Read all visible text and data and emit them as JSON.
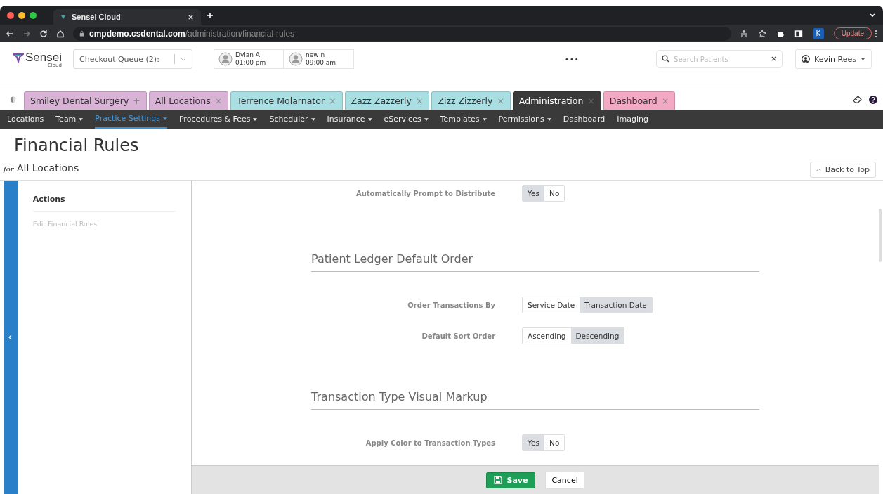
{
  "browser": {
    "tab_title": "Sensei Cloud",
    "url_host": "cmpdemo.csdental.com",
    "url_path": "/administration/financial-rules",
    "avatar_letter": "K",
    "update_label": "Update"
  },
  "header": {
    "logo": "Sensei",
    "logo_sub": "Cloud",
    "checkout_queue": "Checkout Queue (2):",
    "appointments": [
      {
        "name": "Dylan A",
        "time": "01:00 pm"
      },
      {
        "name": "new n",
        "time": "09:00 am"
      }
    ],
    "more": "•••",
    "search_placeholder": "Search Patients",
    "user": "Kevin Rees"
  },
  "tabs": [
    {
      "label": "Smiley Dental Surgery",
      "mark": "+",
      "color": "#d9b3d6",
      "selected": false
    },
    {
      "label": "All Locations",
      "mark": "×",
      "color": "#d9b3d6",
      "selected": false
    },
    {
      "label": "Terrence Molarnator",
      "mark": "×",
      "color": "#a9dfe3",
      "selected": false
    },
    {
      "label": "Zazz Zazzerly",
      "mark": "×",
      "color": "#a9dfe3",
      "selected": false
    },
    {
      "label": "Zizz Zizzerly",
      "mark": "×",
      "color": "#a9dfe3",
      "selected": false
    },
    {
      "label": "Administration",
      "mark": "×",
      "color": "#3a3a3a",
      "selected": true
    },
    {
      "label": "Dashboard",
      "mark": "×",
      "color": "#f3a9c4",
      "selected": false
    }
  ],
  "nav": [
    {
      "label": "Locations",
      "dropdown": false,
      "selected": false
    },
    {
      "label": "Team",
      "dropdown": true,
      "selected": false
    },
    {
      "label": "Practice Settings",
      "dropdown": true,
      "selected": true
    },
    {
      "label": "Procedures & Fees",
      "dropdown": true,
      "selected": false
    },
    {
      "label": "Scheduler",
      "dropdown": true,
      "selected": false
    },
    {
      "label": "Insurance",
      "dropdown": true,
      "selected": false
    },
    {
      "label": "eServices",
      "dropdown": true,
      "selected": false
    },
    {
      "label": "Templates",
      "dropdown": true,
      "selected": false
    },
    {
      "label": "Permissions",
      "dropdown": true,
      "selected": false
    },
    {
      "label": "Dashboard",
      "dropdown": false,
      "selected": false
    },
    {
      "label": "Imaging",
      "dropdown": false,
      "selected": false
    }
  ],
  "page": {
    "title": "Financial Rules",
    "subtitle_prefix": "for",
    "subtitle": "All Locations",
    "back_to_top": "Back to Top"
  },
  "sidebar": {
    "heading": "Actions",
    "items": [
      {
        "label": "Edit Financial Rules"
      }
    ]
  },
  "content": [
    {
      "kind": "row",
      "label": "Automatically Prompt to Distribute",
      "options": [
        {
          "label": "Yes",
          "selected": true
        },
        {
          "label": "No",
          "selected": false
        }
      ]
    },
    {
      "kind": "heading",
      "label": "Patient Ledger Default Order"
    },
    {
      "kind": "row",
      "label": "Order Transactions By",
      "options": [
        {
          "label": "Service Date",
          "selected": false
        },
        {
          "label": "Transaction Date",
          "selected": true
        }
      ]
    },
    {
      "kind": "row",
      "label": "Default Sort Order",
      "options": [
        {
          "label": "Ascending",
          "selected": false
        },
        {
          "label": "Descending",
          "selected": true
        }
      ]
    },
    {
      "kind": "heading",
      "label": "Transaction Type Visual Markup"
    },
    {
      "kind": "row",
      "label": "Apply Color to Transaction Types",
      "options": [
        {
          "label": "Yes",
          "selected": true
        },
        {
          "label": "No",
          "selected": false
        }
      ]
    }
  ],
  "footer": {
    "save": "Save",
    "cancel": "Cancel"
  }
}
